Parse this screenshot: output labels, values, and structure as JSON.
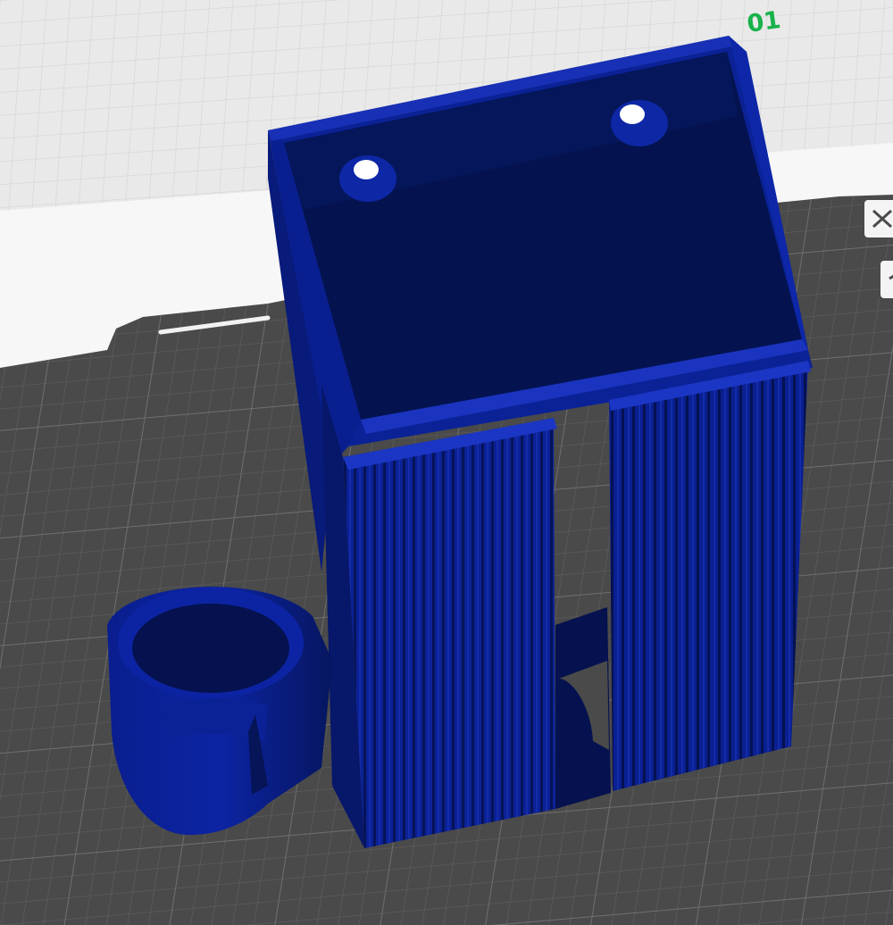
{
  "viewport": {
    "plate_label": "01",
    "colors": {
      "background": "#e9e9e9",
      "grid_light": "#d4d4d4",
      "plate": "#4a4a4a",
      "plate_grid": "#5c5c5c",
      "plate_grid_major": "#6c6c6c",
      "model": "#0a1f8f",
      "model_dark": "#061560",
      "model_interior": "#04134f",
      "label_color": "#18b24a"
    },
    "tools": [
      {
        "icon": "close-x-icon"
      },
      {
        "icon": "toggle-icon"
      }
    ]
  }
}
